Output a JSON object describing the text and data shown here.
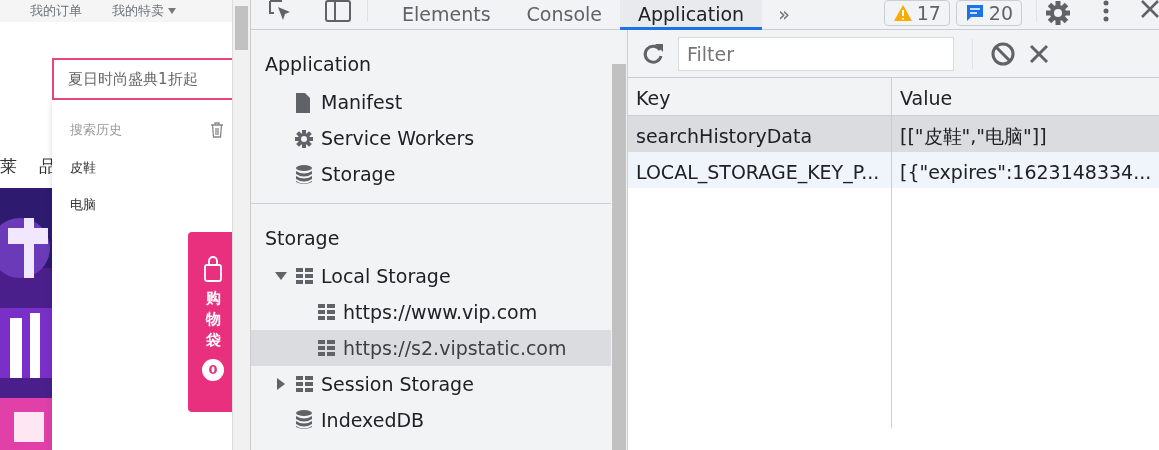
{
  "page": {
    "top_links": [
      {
        "label": "我的订单",
        "caret": false
      },
      {
        "label": "我的特卖",
        "caret": true
      }
    ],
    "search": {
      "value": "夏日时尚盛典1折起"
    },
    "nav": [
      "莱",
      "品"
    ],
    "banner": {
      "kind": "picture"
    },
    "search_history": {
      "title": "搜索历史",
      "items": [
        "皮鞋",
        "电脑"
      ]
    },
    "cart": {
      "label": "购物袋",
      "count": "0"
    }
  },
  "devtools": {
    "tabs": [
      {
        "label": "Elements",
        "selected": false
      },
      {
        "label": "Console",
        "selected": false
      },
      {
        "label": "Application",
        "selected": true
      }
    ],
    "more": "»",
    "warnings": "17",
    "messages": "20",
    "sidebar": [
      {
        "title": "Application",
        "items": [
          {
            "label": "Manifest",
            "kind": "file",
            "selected": false
          },
          {
            "label": "Service Workers",
            "kind": "gear",
            "selected": false
          },
          {
            "label": "Storage",
            "kind": "database",
            "selected": false
          }
        ]
      },
      {
        "title": "Storage",
        "items": [
          {
            "label": "Local Storage",
            "kind": "table",
            "selected": false,
            "expanded": true,
            "children": [
              {
                "label": "https://www.vip.com",
                "kind": "table",
                "selected": false
              },
              {
                "label": "https://s2.vipstatic.com",
                "kind": "table",
                "selected": true
              }
            ]
          },
          {
            "label": "Session Storage",
            "kind": "table",
            "selected": false,
            "expanded": false
          },
          {
            "label": "IndexedDB",
            "kind": "database",
            "selected": false
          }
        ]
      }
    ],
    "filter": {
      "placeholder": "Filter"
    },
    "table": {
      "columns": [
        "Key",
        "Value"
      ],
      "rows": [
        {
          "key": "searchHistoryData",
          "value": "[[\"皮鞋\",\"电脑\"]]",
          "selected": true
        },
        {
          "key": "LOCAL_STORAGE_KEY_P...",
          "value": "[{\"expires\":1623148334...",
          "selected": false
        }
      ]
    }
  }
}
